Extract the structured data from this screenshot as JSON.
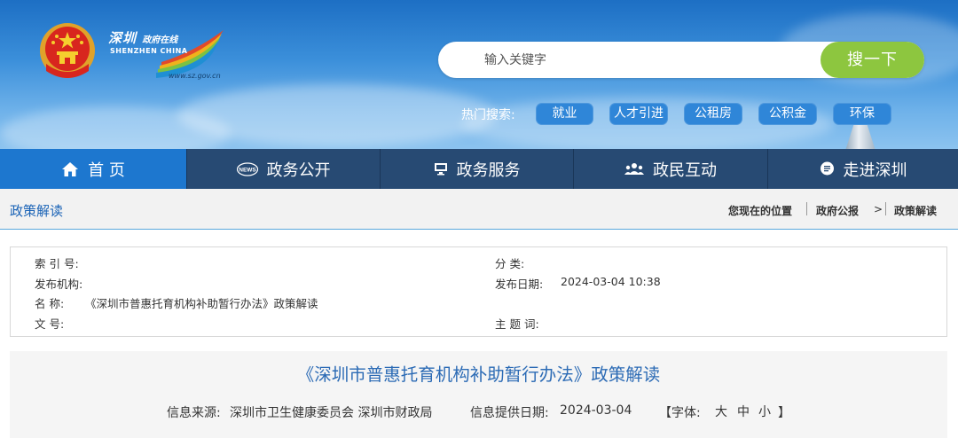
{
  "header": {
    "logo": {
      "cn_city": "深圳",
      "cn_tag": "政府在线",
      "en": "SHENZHEN CHINA",
      "url": "www.sz.gov.cn"
    },
    "search": {
      "placeholder": "输入关键字",
      "button_label": "搜一下"
    },
    "hot_search": {
      "label": "热门搜索:",
      "tags": [
        "就业",
        "人才引进",
        "公租房",
        "公积金",
        "环保"
      ]
    }
  },
  "nav": {
    "items": [
      {
        "label": "首 页",
        "icon": "home-icon"
      },
      {
        "label": "政务公开",
        "icon": "news-icon"
      },
      {
        "label": "政务服务",
        "icon": "monitor-icon"
      },
      {
        "label": "政民互动",
        "icon": "people-icon"
      },
      {
        "label": "走进深圳",
        "icon": "chat-bubble-icon"
      }
    ]
  },
  "breadcrumb": {
    "section_title": "政策解读",
    "location_label": "您现在的位置",
    "path": [
      "政府公报",
      "政策解读"
    ],
    "separator": ">"
  },
  "info": {
    "index_no_label": "索 引 号:",
    "index_no": "",
    "category_label": "分 类:",
    "category": "",
    "publisher_label": "发布机构:",
    "publisher": "",
    "publish_date_label": "发布日期:",
    "publish_date": "2024-03-04 10:38",
    "name_label": "名 称:",
    "name": "《深圳市普惠托育机构补助暂行办法》政策解读",
    "doc_no_label": "文 号:",
    "doc_no": "",
    "keywords_label": "主 题 词:",
    "keywords": ""
  },
  "article": {
    "title": "《深圳市普惠托育机构补助暂行办法》政策解读",
    "source_label": "信息来源:",
    "source": "深圳市卫生健康委员会 深圳市财政局",
    "date_label": "信息提供日期:",
    "date": "2024-03-04",
    "font_label_open": "【字体:",
    "font_large": "大",
    "font_medium": "中",
    "font_small": "小",
    "font_label_close": "】"
  },
  "colors": {
    "nav_bg": "#274a73",
    "nav_active": "#1d77cf",
    "search_button": "#8dc63f",
    "hot_tag": "#2f86d8",
    "title_blue": "#2c6bb5"
  }
}
